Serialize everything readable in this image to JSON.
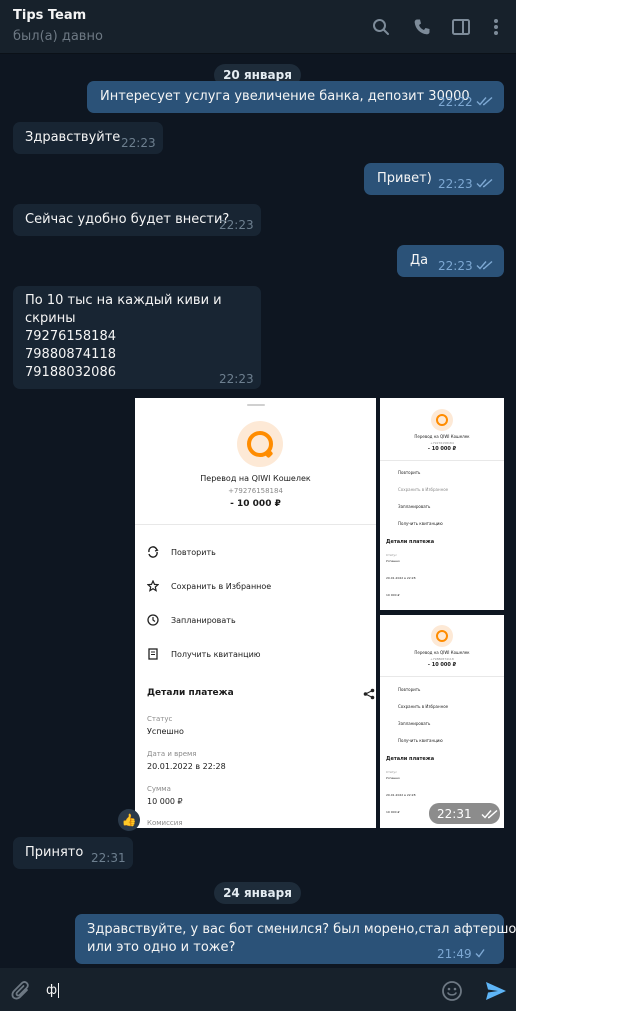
{
  "header": {
    "title": "Tips Team",
    "status": "был(а) давно"
  },
  "dates": {
    "first": "20 января",
    "second": "24 января"
  },
  "messages": [
    {
      "text": "Интересует услуга увеличение банка, депозит 30000",
      "time": "22:22"
    },
    {
      "text": "Здравствуйте",
      "time": "22:23"
    },
    {
      "text": "Привет)",
      "time": "22:23"
    },
    {
      "text": "Сейчас удобно будет внести?",
      "time": "22:23"
    },
    {
      "text": "Да",
      "time": "22:23"
    },
    {
      "line1": "По 10 тыс на каждый киви и скрины",
      "line2": "79276158184",
      "line3": "79880874118",
      "line4": "79188032086",
      "time": "22:23"
    },
    {
      "text": "Принято",
      "time": "22:31"
    },
    {
      "line1": "Здравствуйте, у вас бот сменился? был морено,стал афтершок,",
      "line2": "или это одно и тоже?",
      "time": "21:49"
    }
  ],
  "media": {
    "time": "22:31",
    "reaction": "👍",
    "receipt": {
      "title": "Перевод на QIWI Кошелек",
      "phone": "+79276158184",
      "amount": "- 10 000 ₽",
      "actions": [
        "Повторить",
        "Сохранить в Избранное",
        "Запланировать",
        "Получить квитанцию"
      ],
      "details_title": "Детали платежа",
      "status_label": "Статус",
      "status_value": "Успешно",
      "date_label": "Дата и время",
      "date_value": "20.01.2022 в 22:28",
      "sum_label": "Сумма",
      "sum_value": "10 000 ₽",
      "fee_label": "Комиссия"
    },
    "receipt2": {
      "phone": "+79880874118"
    }
  },
  "composer": {
    "value": "ф"
  },
  "colors": {
    "background": "#0e1621",
    "incoming": "#182533",
    "outgoing": "#2b5278",
    "accent": "#5eb5f7",
    "qiwi_orange": "#ff8c00"
  },
  "icons": [
    "search-icon",
    "phone-icon",
    "sidebar-icon",
    "more-icon",
    "double-check-icon",
    "paperclip-icon",
    "emoji-icon",
    "send-icon",
    "thumbs-up-icon",
    "qiwi-logo",
    "refresh-icon",
    "star-icon",
    "clock-icon",
    "receipt-icon",
    "share-icon"
  ]
}
